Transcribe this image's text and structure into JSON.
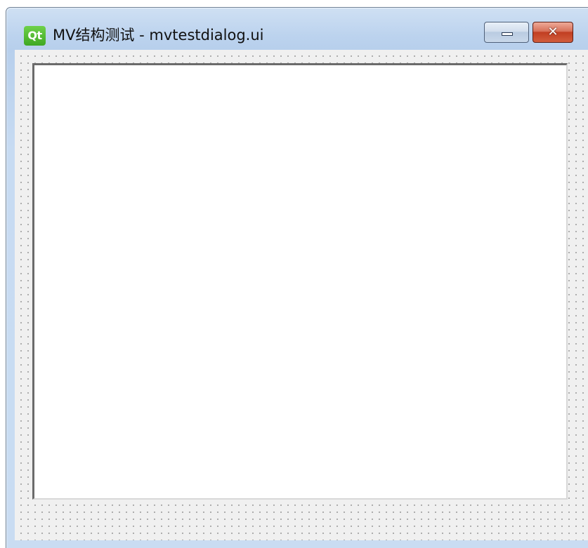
{
  "window": {
    "app_icon_text": "Qt",
    "title": "MV结构测试 - mvtestdialog.ui",
    "close_glyph": "✕"
  },
  "icons": {
    "app": "qt-logo-icon",
    "minimize": "minimize-icon",
    "close": "close-icon"
  },
  "colors": {
    "titlebar": "#bcd3ee",
    "client_background": "#f0f0f0",
    "close_button": "#c13e22",
    "qt_green": "#41cd52"
  },
  "content": {
    "list_view_items": []
  }
}
